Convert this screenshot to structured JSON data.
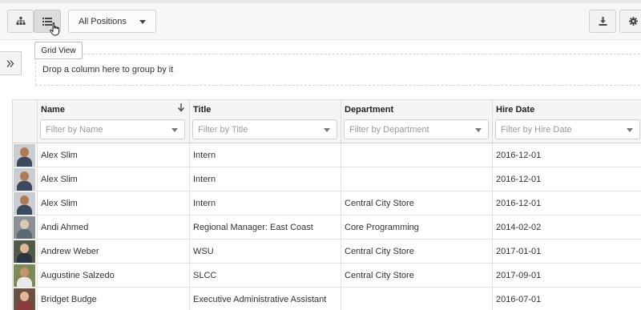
{
  "toolbar": {
    "org_view_icon": "sitemap-icon",
    "grid_view_icon": "list-icon",
    "positions_dropdown": {
      "selected": "All Positions"
    },
    "download_icon": "download-icon",
    "settings_icon": "gear-icon"
  },
  "tooltip": {
    "text": "Grid View"
  },
  "group_zone": {
    "text": "Drop a column here to group by it"
  },
  "grid": {
    "columns": [
      {
        "label": "Name",
        "filter_placeholder": "Filter by Name",
        "sorted": "descending"
      },
      {
        "label": "Title",
        "filter_placeholder": "Filter by Title"
      },
      {
        "label": "Department",
        "filter_placeholder": "Filter by Department"
      },
      {
        "label": "Hire Date",
        "filter_placeholder": "Filter by Hire Date"
      }
    ],
    "rows": [
      {
        "name": "Alex Slim",
        "title": "Intern",
        "department": "",
        "hire_date": "2016-12-01",
        "avatar": {
          "bg": "#c9cdd2",
          "skin": "#b07a55",
          "shirt": "#3b4a5c"
        }
      },
      {
        "name": "Alex Slim",
        "title": "Intern",
        "department": "",
        "hire_date": "2016-12-01",
        "avatar": {
          "bg": "#c9cdd2",
          "skin": "#b07a55",
          "shirt": "#3b4a5c"
        }
      },
      {
        "name": "Alex Slim",
        "title": "Intern",
        "department": "Central City Store",
        "hire_date": "2016-12-01",
        "avatar": {
          "bg": "#c9cdd2",
          "skin": "#b07a55",
          "shirt": "#3b4a5c"
        }
      },
      {
        "name": "Andi Ahmed",
        "title": "Regional Manager: East Coast",
        "department": "Core Programming",
        "hire_date": "2014-02-02",
        "avatar": {
          "bg": "#8a8f94",
          "skin": "#d8c9b8",
          "shirt": "#5e6a73"
        }
      },
      {
        "name": "Andrew Weber",
        "title": "WSU",
        "department": "Central City Store",
        "hire_date": "2017-01-01",
        "avatar": {
          "bg": "#4f5a4a",
          "skin": "#e0b896",
          "shirt": "#2c3440"
        }
      },
      {
        "name": "Augustine Salzedo",
        "title": "SLCC",
        "department": "Central City Store",
        "hire_date": "2017-09-01",
        "avatar": {
          "bg": "#7d8a55",
          "skin": "#c7936c",
          "shirt": "#e9e9e9"
        }
      },
      {
        "name": "Bridget Budge",
        "title": "Executive Administrative Assistant",
        "department": "",
        "hire_date": "2016-07-01",
        "avatar": {
          "bg": "#6b5144",
          "skin": "#e3b79a",
          "shirt": "#8b3b3b"
        }
      }
    ]
  }
}
